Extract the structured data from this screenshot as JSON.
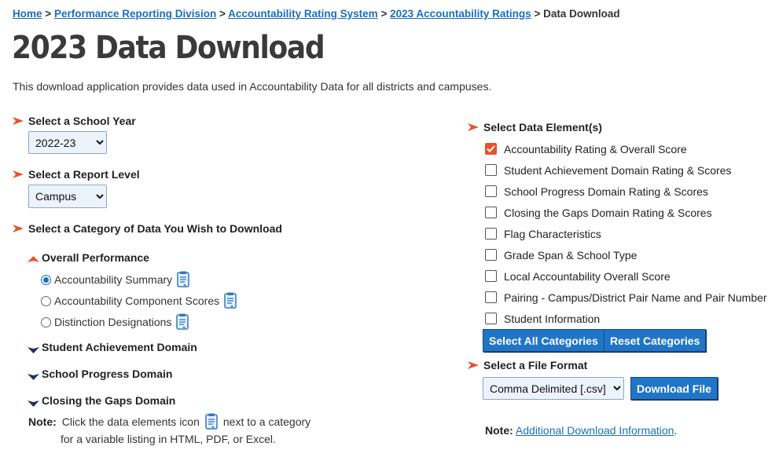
{
  "breadcrumb": {
    "home": "Home",
    "division": "Performance Reporting Division",
    "system": "Accountability Rating System",
    "ratings": "2023 Accountability Ratings",
    "current": "Data Download",
    "separator": ">"
  },
  "page": {
    "title": "2023 Data Download",
    "intro": "This download application provides data used in Accountability Data for all districts and campuses."
  },
  "school_year": {
    "label": "Select a School Year",
    "selected": "2022-23"
  },
  "report_level": {
    "label": "Select a Report Level",
    "selected": "Campus"
  },
  "category": {
    "label": "Select a Category of Data You Wish to Download",
    "groups": [
      {
        "label": "Overall Performance",
        "expanded": true,
        "options": [
          {
            "label": "Accountability Summary",
            "selected": true
          },
          {
            "label": "Accountability Component Scores",
            "selected": false
          },
          {
            "label": "Distinction Designations",
            "selected": false
          }
        ]
      },
      {
        "label": "Student Achievement Domain",
        "expanded": false
      },
      {
        "label": "School Progress Domain",
        "expanded": false
      },
      {
        "label": "Closing the Gaps Domain",
        "expanded": false
      }
    ],
    "note_label": "Note:",
    "note_text_before": "Click the data elements icon",
    "note_text_after": "next to a category",
    "note_text_line2": "for a variable listing in HTML, PDF, or Excel."
  },
  "data_elements": {
    "label": "Select Data Element(s)",
    "items": [
      {
        "label": "Accountability Rating & Overall Score",
        "checked": true
      },
      {
        "label": "Student Achievement Domain Rating & Scores",
        "checked": false
      },
      {
        "label": "School Progress Domain Rating & Scores",
        "checked": false
      },
      {
        "label": "Closing the Gaps Domain Rating & Scores",
        "checked": false
      },
      {
        "label": "Flag Characteristics",
        "checked": false
      },
      {
        "label": "Grade Span & School Type",
        "checked": false
      },
      {
        "label": "Local Accountability Overall Score",
        "checked": false
      },
      {
        "label": "Pairing - Campus/District Pair Name and Pair Number",
        "checked": false
      },
      {
        "label": "Student Information",
        "checked": false
      }
    ],
    "select_all_label": "Select All Categories",
    "reset_label": "Reset Categories"
  },
  "file_format": {
    "label": "Select a File Format",
    "selected": "Comma Delimited [.csv]",
    "download_label": "Download File"
  },
  "download_note": {
    "label": "Note:",
    "link": "Additional Download Information",
    "suffix": "."
  },
  "colors": {
    "link": "#1a6fbf",
    "accent_orange": "#e6522c",
    "button_blue": "#2175c7",
    "navy_triangle": "#1f2f66"
  }
}
